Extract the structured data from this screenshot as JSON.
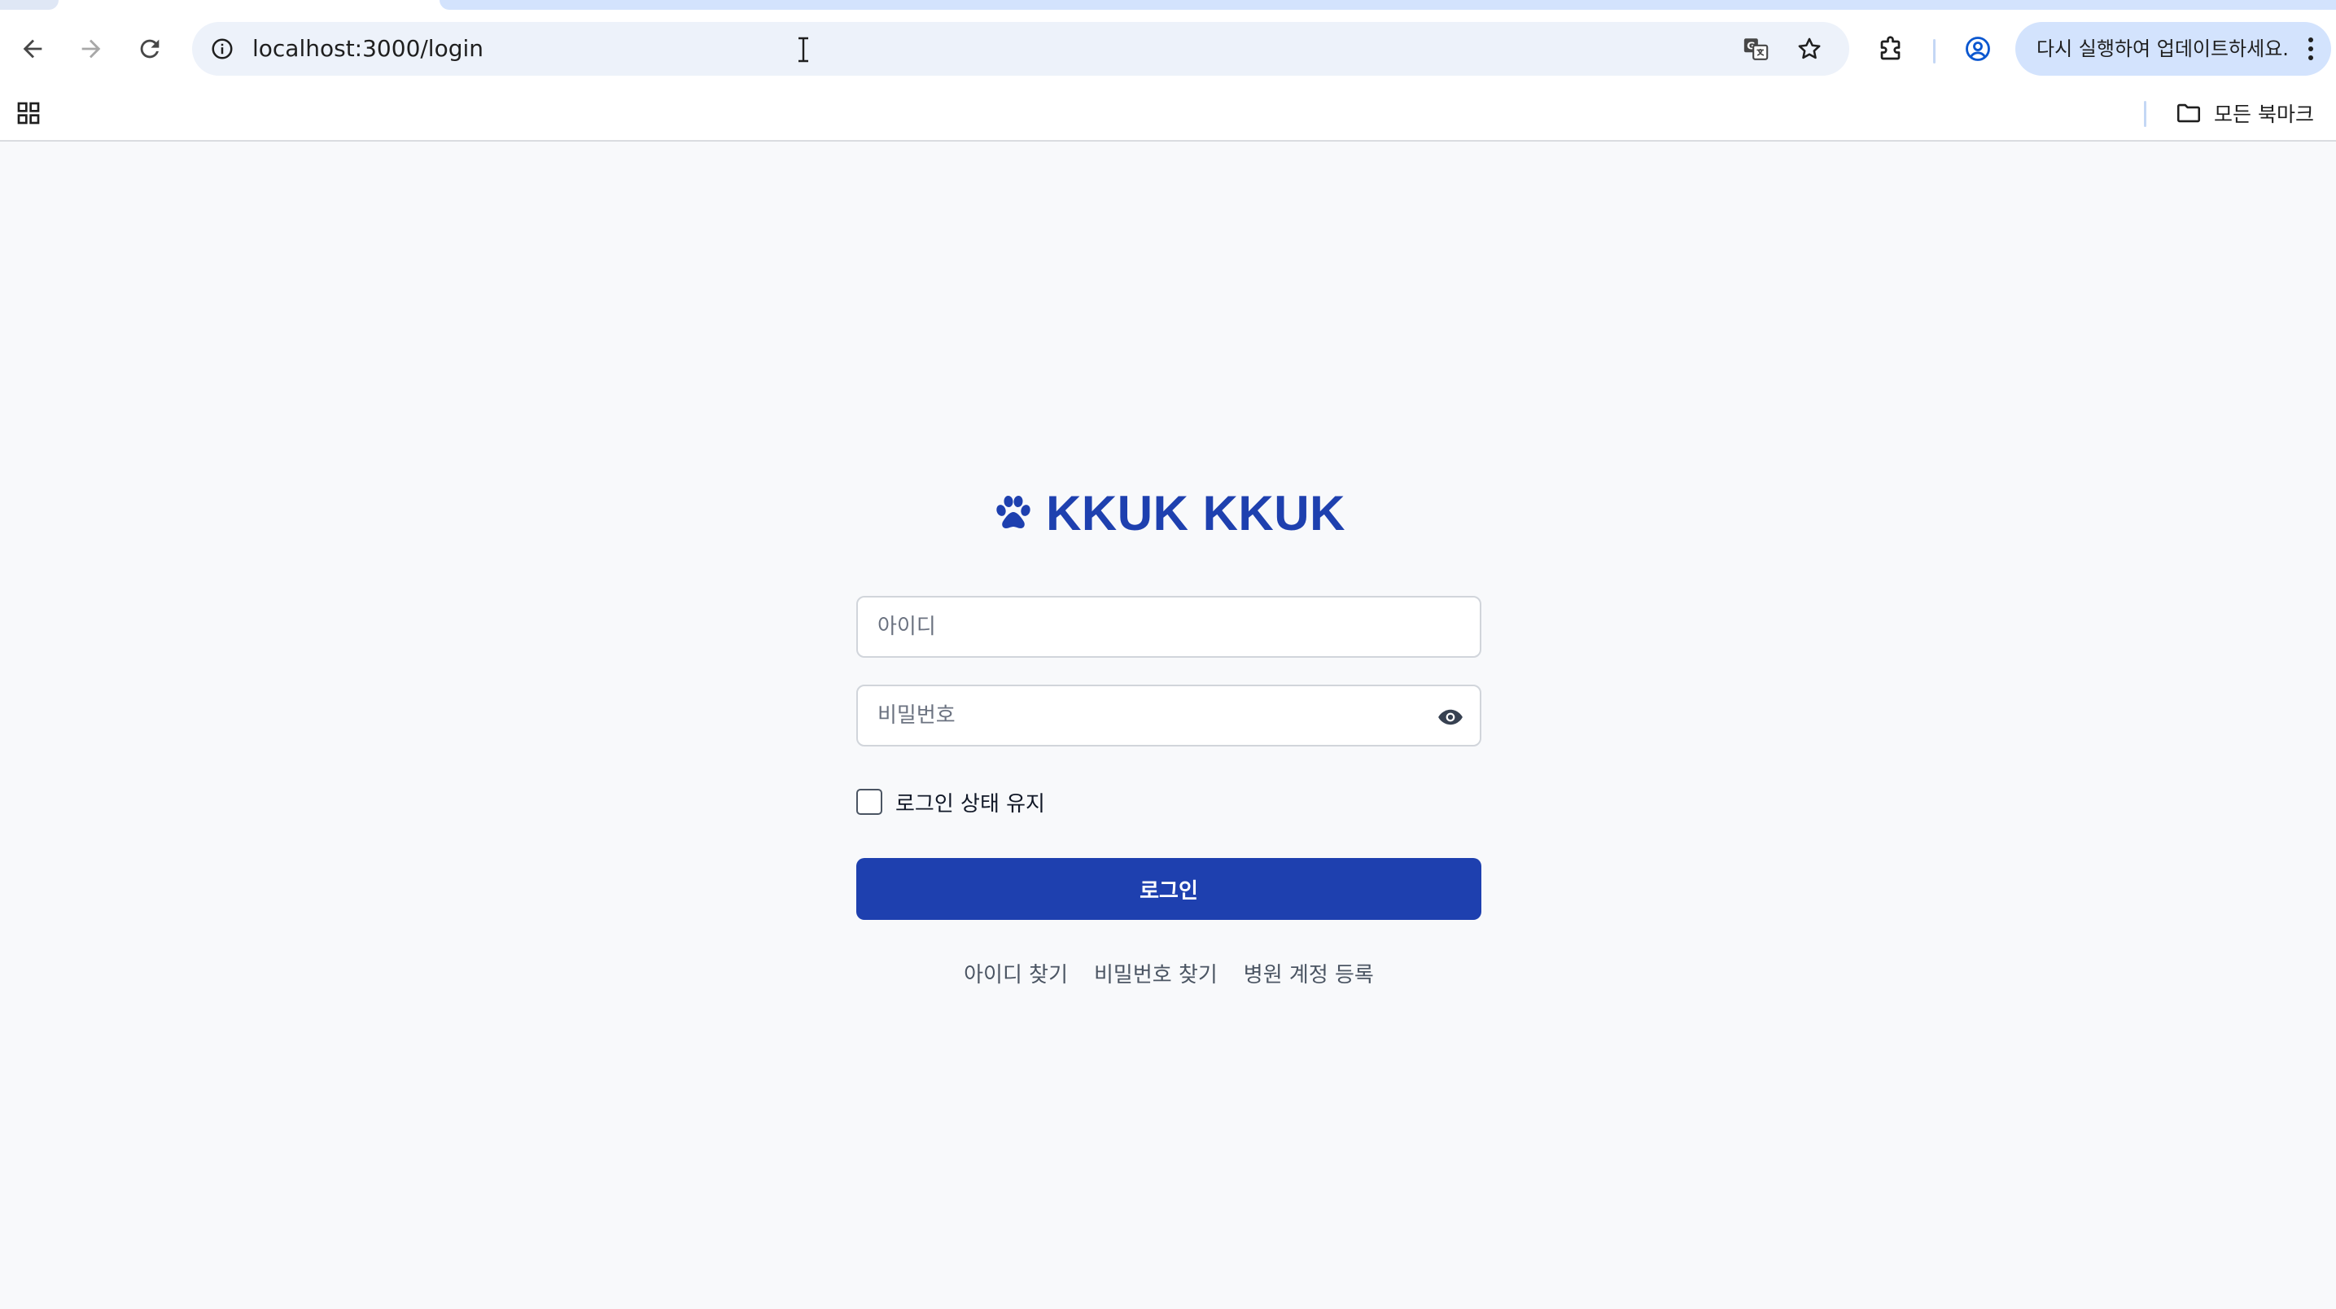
{
  "browser": {
    "url": "localhost:3000/login",
    "update_chip_label": "다시 실행하여 업데이트하세요.",
    "bookmarks_folder_label": "모든 북마크",
    "accent_color": "#d3e3fd"
  },
  "login": {
    "brand_text": "KKUK KKUK",
    "brand_color": "#1e40af",
    "id_placeholder": "아이디",
    "password_placeholder": "비밀번호",
    "remember_label": "로그인 상태 유지",
    "login_button_label": "로그인",
    "links": {
      "find_id": "아이디 찾기",
      "find_password": "비밀번호 찾기",
      "register_hospital": "병원 계정 등록"
    }
  }
}
